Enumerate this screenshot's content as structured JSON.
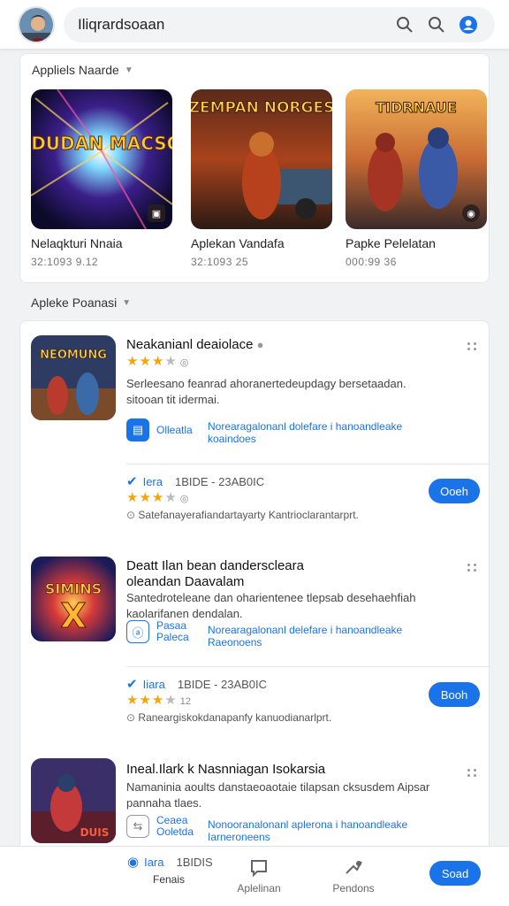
{
  "header": {
    "search_text": "Iliqrardsoaan",
    "icons": [
      "search-icon",
      "search-icon",
      "account-icon"
    ]
  },
  "featured": {
    "title": "Appliels Naarde",
    "items": [
      {
        "name": "Nelaqkturi Nnaia",
        "meta": "32:1093 9.12",
        "art_text": "TADUDAN MACSON"
      },
      {
        "name": "Aplekan Vandafa",
        "meta": "32:1093 25",
        "art_text": "ZEMPAN NORGES"
      },
      {
        "name": "Papke Pelelatan",
        "meta": "000:99 36",
        "art_text": "TIDRNAUE"
      }
    ]
  },
  "popular": {
    "title": "Apleke Poanasi",
    "items": [
      {
        "title": "Neakanianl deaiolace",
        "art_text": "NEOMUNG",
        "rating": 3,
        "desc": "Serleesano feanrad ahoranertedeupdagy bersetaadan. sitooan tit idermai.",
        "link_label": "Olleatla",
        "link_text": "Norearagalonanl dolefare i hanoandleake koaindoes",
        "verify_label": "Iera",
        "verify_meta": "1BIDE - 23AB0IC",
        "rating2": 3,
        "summary": "Satefanayerafiandartayarty Kantrioclarantarprt.",
        "button": "Ooeh"
      },
      {
        "title": "Deatt Ilan bean danderscleara",
        "title2": "oleandan Daavalam",
        "art_text": "SIMINS X",
        "desc": "Santedroteleane dan oharientenee tlepsab desehaehfiah kaolarifanen dendalan.",
        "link_label": "Pasaa Paleca",
        "link_text": "Norearagalonanl delefare i hanoandleake Raeonoens",
        "verify_label": "Iiara",
        "verify_meta": "1BIDE - 23AB0IC",
        "rating2": 3,
        "summary": "Raneargiskokdanapanfy kanuodianarlprt.",
        "button": "Booh"
      },
      {
        "title": "Ineal.Ilark k Nasnniagan Isokarsia",
        "art_text": "DUIS",
        "desc": "Namaninia aoults danstaeoaotaie tilapsan cksusdem Aipsar pannaha tlaes.",
        "link_label": "Ceaea Ooletda",
        "link_text": "Nonooranalonanl aplerona i hanoandleake Iarneroneens"
      }
    ]
  },
  "bottom_nav": {
    "verify_label": "Iara",
    "verify_meta": "1BIDIS",
    "items": [
      "Fenais",
      "Aplelinan",
      "Pendons"
    ],
    "button": "Soad"
  },
  "colors": {
    "accent": "#1a73e8",
    "star": "#f2a60c"
  }
}
